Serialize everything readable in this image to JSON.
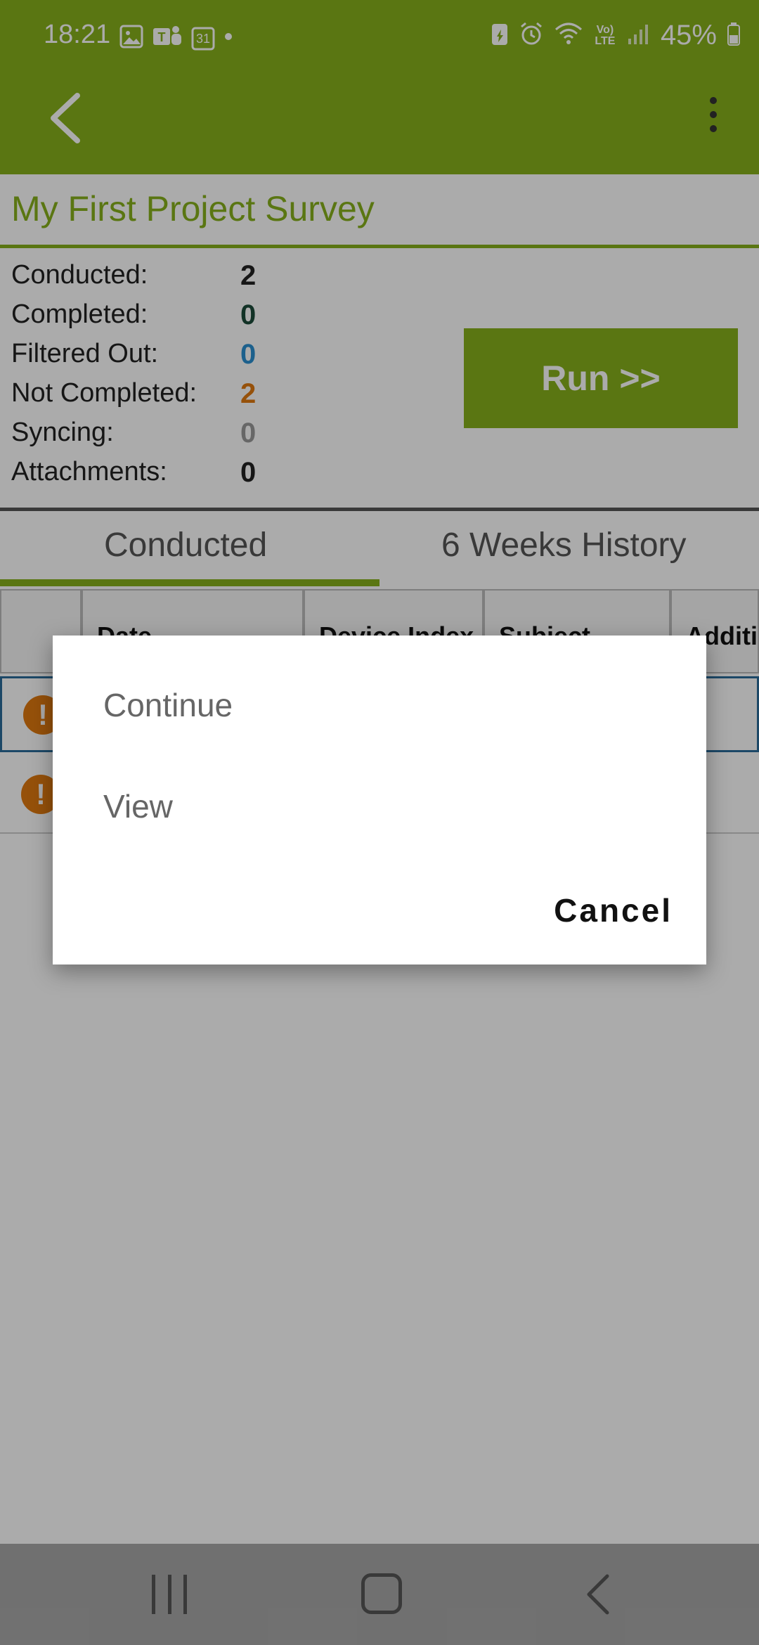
{
  "status_bar": {
    "time": "18:21",
    "left_icons": [
      "gallery-icon",
      "teams-icon",
      "calendar-icon",
      "dot-icon"
    ],
    "calendar_day": "31",
    "right_icons": [
      "battery-saver-icon",
      "alarm-icon",
      "wifi-icon",
      "volte-icon",
      "signal-icon",
      "battery-icon"
    ],
    "volte_text": "Vo) LTE",
    "battery": "45%"
  },
  "app_bar": {
    "back_icon": "back-arrow-icon",
    "menu_icon": "more-vert-icon"
  },
  "survey": {
    "title": "My First Project Survey",
    "stats": [
      {
        "label": "Conducted:",
        "value": "2",
        "color": "#222222"
      },
      {
        "label": "Completed:",
        "value": "0",
        "color": "#1b4b3a"
      },
      {
        "label": "Filtered Out:",
        "value": "0",
        "color": "#2a8fd1"
      },
      {
        "label": "Not Completed:",
        "value": "2",
        "color": "#e07a10"
      },
      {
        "label": "Syncing:",
        "value": "0",
        "color": "#9a9a9a"
      },
      {
        "label": "Attachments:",
        "value": "0",
        "color": "#222222"
      }
    ],
    "run_label": "Run >>"
  },
  "tabs": [
    {
      "label": "Conducted",
      "active": true
    },
    {
      "label": "6 Weeks History",
      "active": false
    }
  ],
  "table": {
    "columns": [
      "",
      "Date",
      "Device Index",
      "Subject",
      "Additio"
    ],
    "rows": [
      {
        "status_icon": "warning-icon",
        "selected": true
      },
      {
        "status_icon": "warning-icon",
        "selected": false
      }
    ]
  },
  "dialog": {
    "options": [
      "Continue",
      "View"
    ],
    "cancel_label": "Cancel"
  },
  "nav_bar": {
    "items": [
      "recents-icon",
      "home-icon",
      "back-icon"
    ]
  },
  "colors": {
    "accent": "#86b01c",
    "warning": "#e07a10",
    "selected_border": "#2a6c9a"
  }
}
